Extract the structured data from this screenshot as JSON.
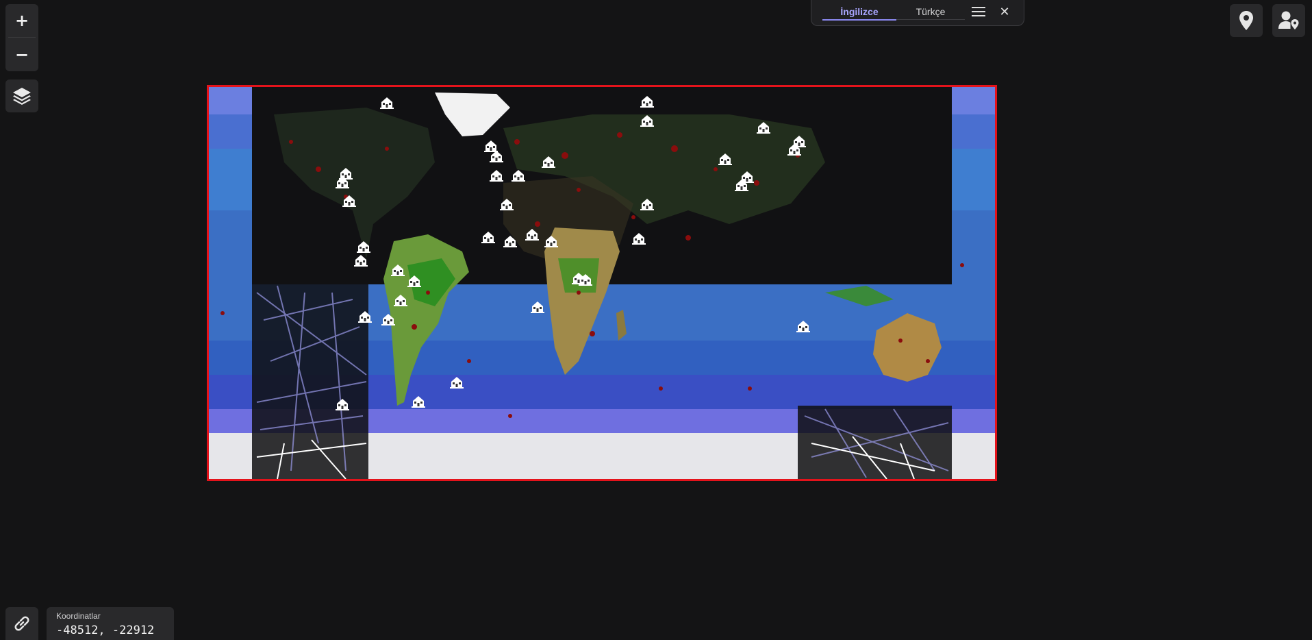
{
  "controls": {
    "zoom_in_label": "+",
    "zoom_out_label": "−"
  },
  "language_panel": {
    "tabs": [
      {
        "label": "İngilizce",
        "selected": true
      },
      {
        "label": "Türkçe",
        "selected": false
      }
    ]
  },
  "coordinates": {
    "label": "Koordinatlar",
    "value": "-48512, -22912"
  },
  "map": {
    "border_color": "#e4131b",
    "background": "#141415",
    "ocean_color": "#3b6fc4",
    "ice_color": "#e6e6ea",
    "marker_icon": "building-marker-icon"
  },
  "colors": {
    "accent": "#a9a6ff",
    "panel": "#29292b"
  }
}
